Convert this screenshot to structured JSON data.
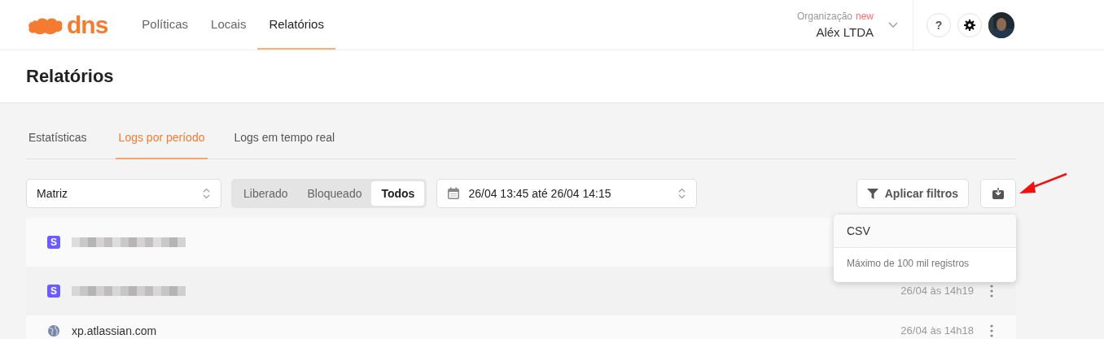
{
  "header": {
    "logo": "dns",
    "nav": [
      {
        "label": "Políticas",
        "selected": false
      },
      {
        "label": "Locais",
        "selected": false
      },
      {
        "label": "Relatórios",
        "selected": true
      }
    ],
    "organization": {
      "label": "Organização",
      "badge": "new",
      "name": "Aléx LTDA"
    },
    "help": "?"
  },
  "page_title": "Relatórios",
  "tabs": [
    {
      "label": "Estatísticas",
      "selected": false
    },
    {
      "label": "Logs por período",
      "selected": true
    },
    {
      "label": "Logs em tempo real",
      "selected": false
    }
  ],
  "filters": {
    "location": "Matriz",
    "status": [
      {
        "label": "Liberado",
        "selected": false
      },
      {
        "label": "Bloqueado",
        "selected": false
      },
      {
        "label": "Todos",
        "selected": true
      }
    ],
    "period": "26/04 13:45 até 26/04 14:15",
    "apply": "Aplicar filtros"
  },
  "logs": [
    {
      "kind": "blocked-app",
      "icon": "S",
      "redacted": true
    },
    {
      "kind": "blocked-app",
      "icon": "S",
      "redacted": true,
      "time": "26/04 às 14h19"
    },
    {
      "kind": "site",
      "domain": "xp.atlassian.com",
      "time": "26/04 às 14h18"
    }
  ],
  "export_menu": {
    "items": [
      {
        "label": "CSV"
      }
    ],
    "note": "Máximo de 100 mil registros"
  }
}
